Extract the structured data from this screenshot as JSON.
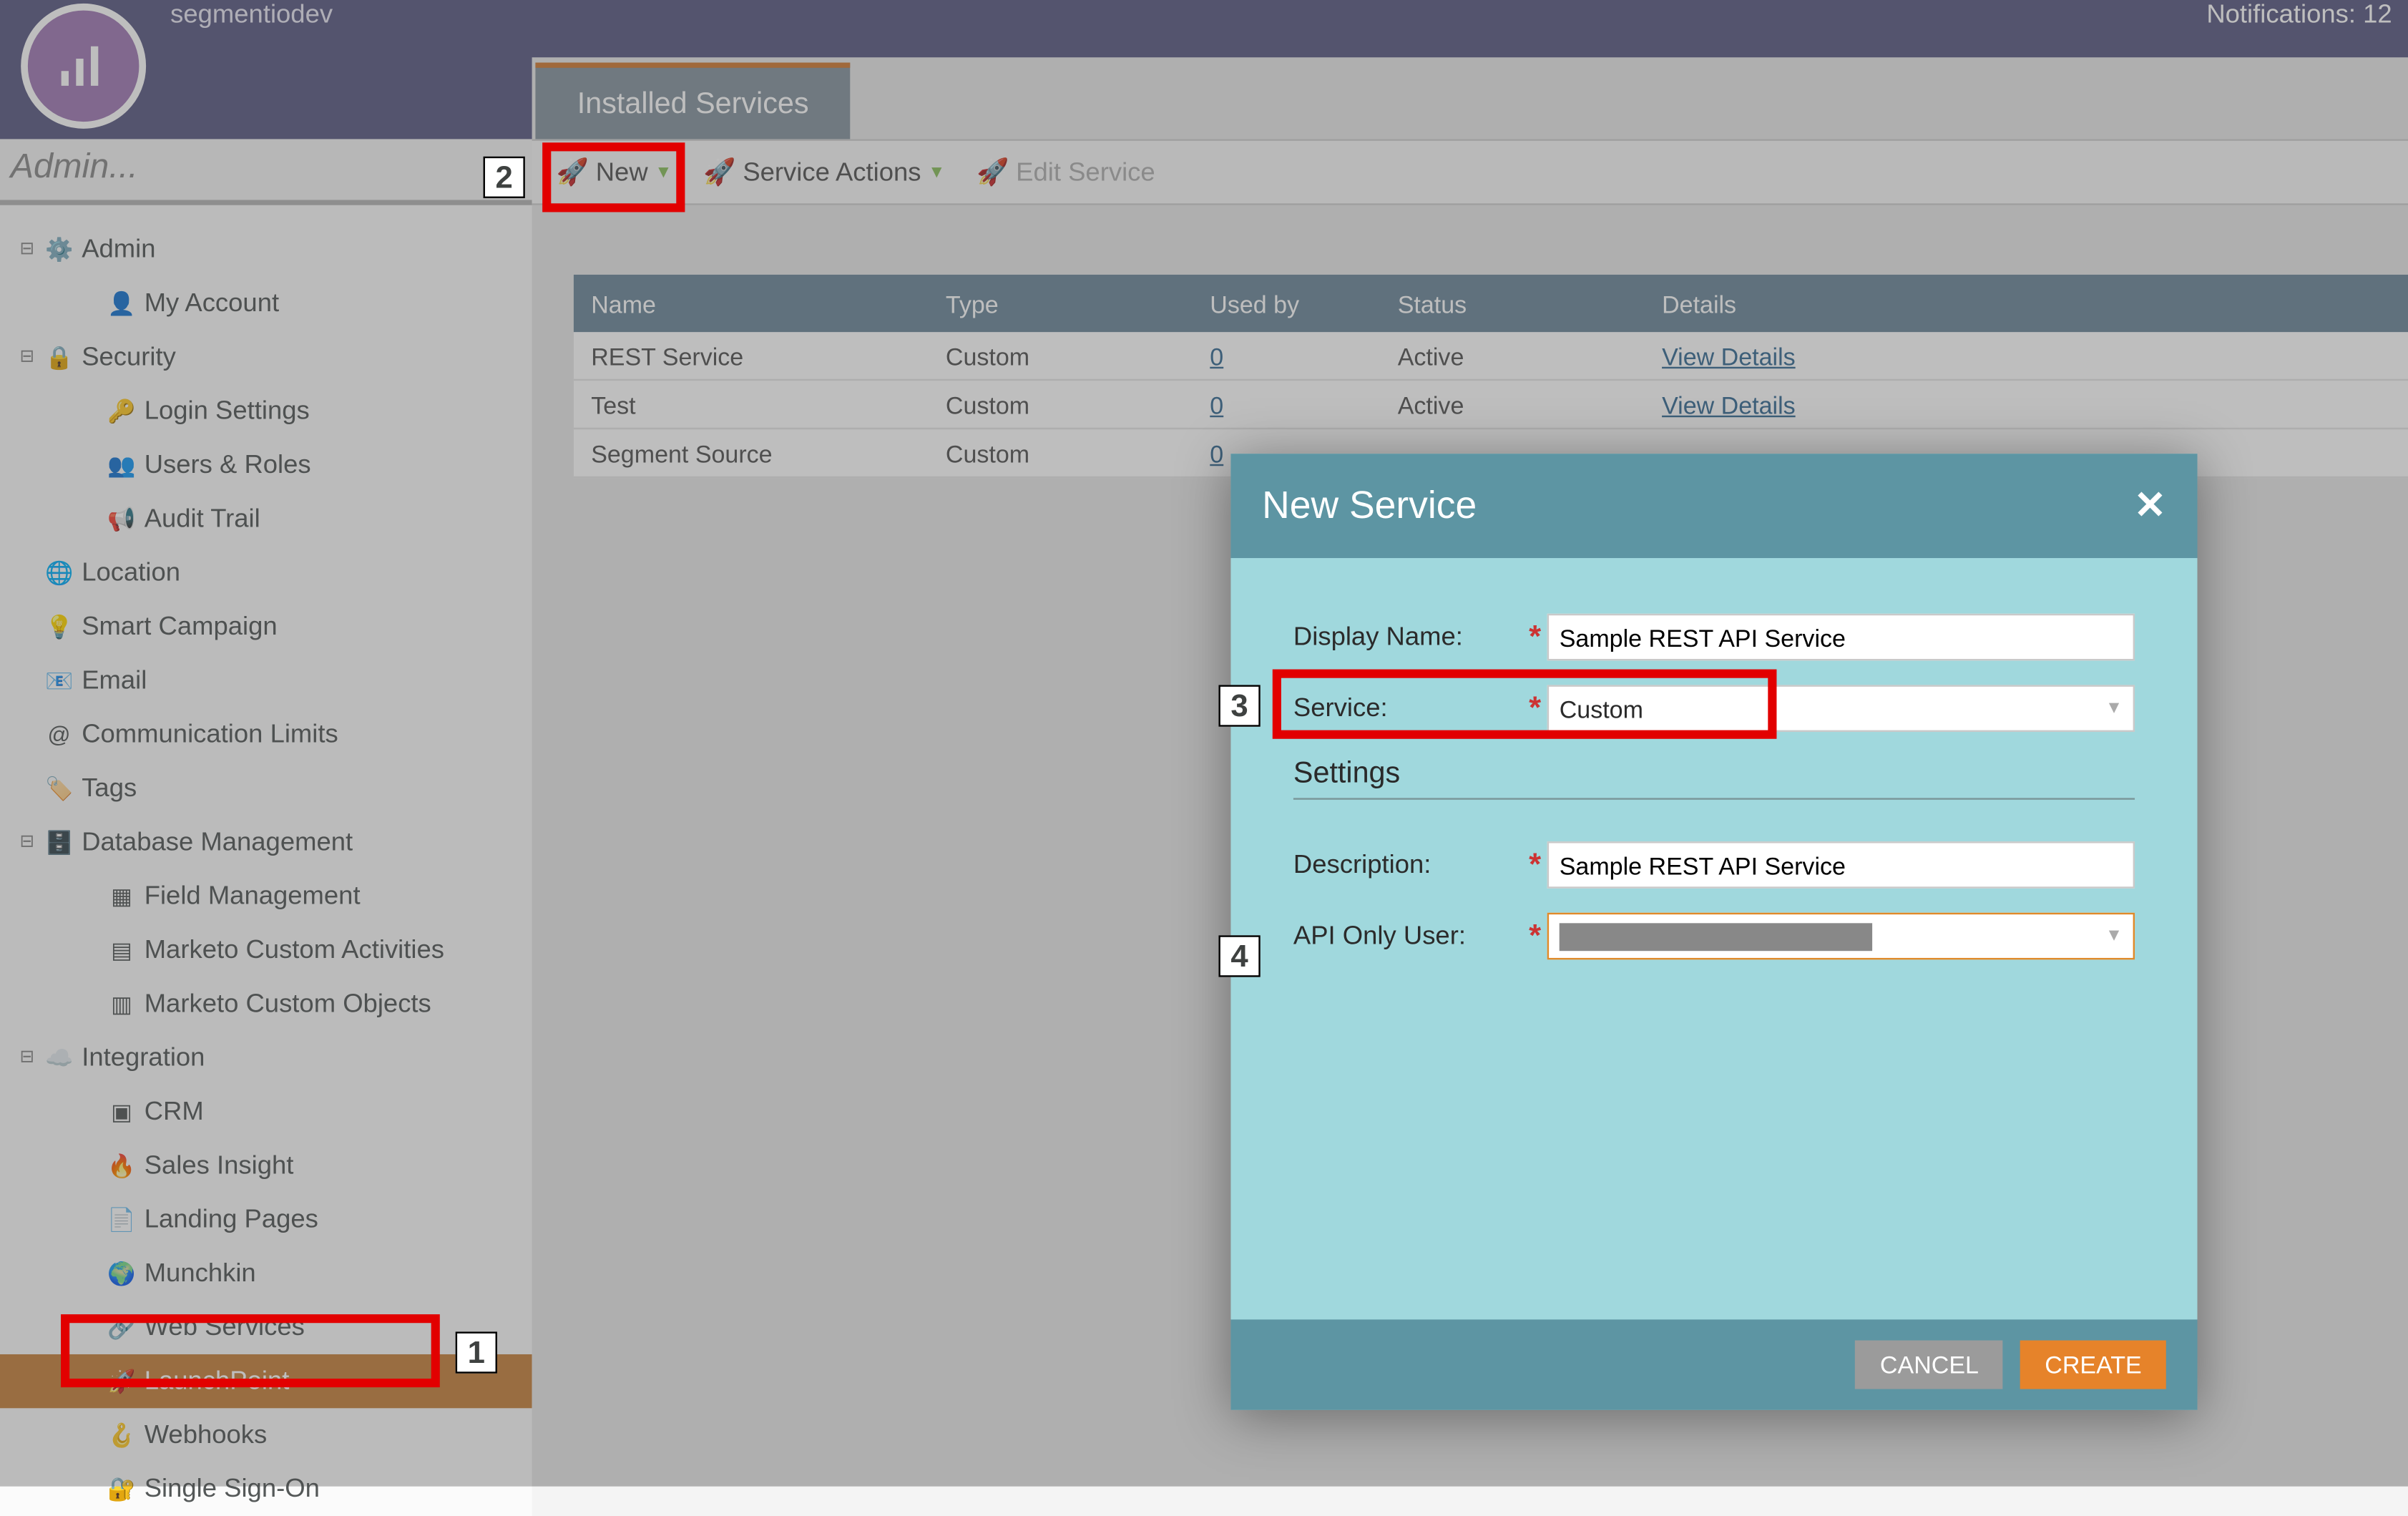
{
  "topbar": {
    "account": "segmentiodev",
    "notifications": "Notifications: 12"
  },
  "breadcrumb": "Admin...",
  "sidebar": {
    "items": [
      {
        "label": "Admin",
        "depth": 0,
        "toggle": "⊟",
        "icon": "gear"
      },
      {
        "label": "My Account",
        "depth": 1,
        "icon": "user"
      },
      {
        "label": "Security",
        "depth": 0,
        "toggle": "⊟",
        "icon": "lock"
      },
      {
        "label": "Login Settings",
        "depth": 1,
        "icon": "key"
      },
      {
        "label": "Users & Roles",
        "depth": 1,
        "icon": "users"
      },
      {
        "label": "Audit Trail",
        "depth": 1,
        "icon": "megaphone"
      },
      {
        "label": "Location",
        "depth": 0,
        "icon": "globe"
      },
      {
        "label": "Smart Campaign",
        "depth": 0,
        "icon": "bulb"
      },
      {
        "label": "Email",
        "depth": 0,
        "icon": "mail"
      },
      {
        "label": "Communication Limits",
        "depth": 0,
        "icon": "at"
      },
      {
        "label": "Tags",
        "depth": 0,
        "icon": "tag"
      },
      {
        "label": "Database Management",
        "depth": 0,
        "toggle": "⊟",
        "icon": "db"
      },
      {
        "label": "Field Management",
        "depth": 1,
        "icon": "field"
      },
      {
        "label": "Marketo Custom Activities",
        "depth": 1,
        "icon": "activities"
      },
      {
        "label": "Marketo Custom Objects",
        "depth": 1,
        "icon": "objects"
      },
      {
        "label": "Integration",
        "depth": 0,
        "toggle": "⊟",
        "icon": "cloud"
      },
      {
        "label": "CRM",
        "depth": 1,
        "icon": "crm"
      },
      {
        "label": "Sales Insight",
        "depth": 1,
        "icon": "fire"
      },
      {
        "label": "Landing Pages",
        "depth": 1,
        "icon": "page"
      },
      {
        "label": "Munchkin",
        "depth": 1,
        "icon": "world"
      },
      {
        "label": "Web Services",
        "depth": 1,
        "icon": "web"
      },
      {
        "label": "LaunchPoint",
        "depth": 1,
        "icon": "rocket",
        "selected": true
      },
      {
        "label": "Webhooks",
        "depth": 1,
        "icon": "hook"
      },
      {
        "label": "Single Sign-On",
        "depth": 1,
        "icon": "sso"
      }
    ]
  },
  "tab": "Installed Services",
  "toolbar": {
    "new": "New",
    "actions": "Service Actions",
    "edit": "Edit Service"
  },
  "grid": {
    "headers": {
      "name": "Name",
      "type": "Type",
      "used": "Used by",
      "status": "Status",
      "details": "Details"
    },
    "rows": [
      {
        "name": "REST Service",
        "type": "Custom",
        "used": "0",
        "status": "Active",
        "details": "View Details"
      },
      {
        "name": "Test",
        "type": "Custom",
        "used": "0",
        "status": "Active",
        "details": "View Details"
      },
      {
        "name": "Segment Source",
        "type": "Custom",
        "used": "0",
        "status": "",
        "details": ""
      }
    ]
  },
  "dialog": {
    "title": "New Service",
    "display_name_label": "Display Name:",
    "display_name_value": "Sample REST API Service",
    "service_label": "Service:",
    "service_value": "Custom",
    "settings_header": "Settings",
    "description_label": "Description:",
    "description_value": "Sample REST API Service",
    "api_user_label": "API Only User:",
    "cancel": "CANCEL",
    "create": "CREATE"
  },
  "markers": {
    "m1": "1",
    "m2": "2",
    "m3": "3",
    "m4": "4"
  }
}
